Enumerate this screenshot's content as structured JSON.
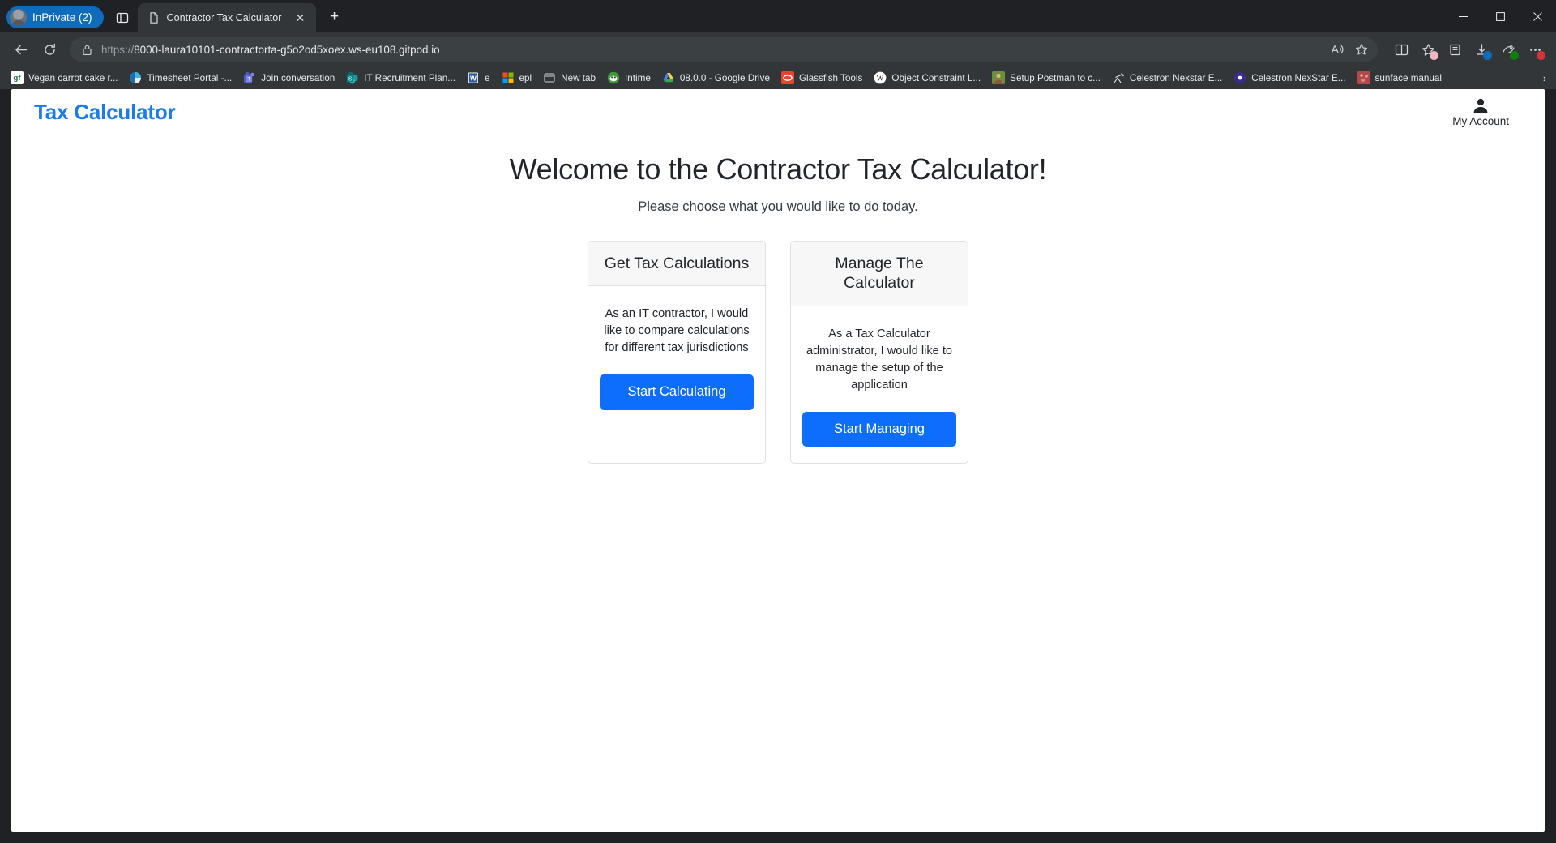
{
  "browser": {
    "profile_pill": "InPrivate (2)",
    "tab": {
      "title": "Contractor Tax Calculator",
      "close_label": "✕"
    },
    "new_tab_label": "+",
    "url": "https://8000-laura10101-contractorta-g5o2od5xoex.ws-eu108.gitpod.io",
    "url_scheme": "https://",
    "url_rest": "8000-laura10101-contractorta-g5o2od5xoex.ws-eu108.gitpod.io",
    "read_aloud_label": "A",
    "favourites_overflow": "›",
    "favourites": [
      {
        "label": "Vegan carrot cake r...",
        "icon": "gf"
      },
      {
        "label": "Timesheet Portal -...",
        "icon": "pie"
      },
      {
        "label": "Join conversation",
        "icon": "teams"
      },
      {
        "label": "IT Recruitment Plan...",
        "icon": "sharepoint"
      },
      {
        "label": "e",
        "icon": "word"
      },
      {
        "label": "epl",
        "icon": "microsoft"
      },
      {
        "label": "New tab",
        "icon": "newtab"
      },
      {
        "label": "Intime",
        "icon": "intime"
      },
      {
        "label": "08.0.0 - Google Drive",
        "icon": "gdrive"
      },
      {
        "label": "Glassfish Tools",
        "icon": "glassfish"
      },
      {
        "label": "Object Constraint L...",
        "icon": "wikipedia"
      },
      {
        "label": "Setup Postman to c...",
        "icon": "photo"
      },
      {
        "label": "Celestron Nexstar E...",
        "icon": "telescope"
      },
      {
        "label": "Celestron NexStar E...",
        "icon": "celestron"
      },
      {
        "label": "sunface manual",
        "icon": "sunface"
      }
    ]
  },
  "app": {
    "brand": "Tax Calculator",
    "account_label": "My Account",
    "heading": "Welcome to the Contractor Tax Calculator!",
    "subheading": "Please choose what you would like to do today.",
    "cards": [
      {
        "title": "Get Tax Calculations",
        "body": "As an IT contractor, I would like to compare calculations for different tax jurisdictions",
        "button": "Start Calculating"
      },
      {
        "title": "Manage The Calculator",
        "body": "As a Tax Calculator administrator, I would like to manage the setup of the application",
        "button": "Start Managing"
      }
    ]
  },
  "colors": {
    "brand_blue": "#1a7bed",
    "button_blue": "#0d6efd",
    "inprivate_blue": "#0f6cbd"
  }
}
